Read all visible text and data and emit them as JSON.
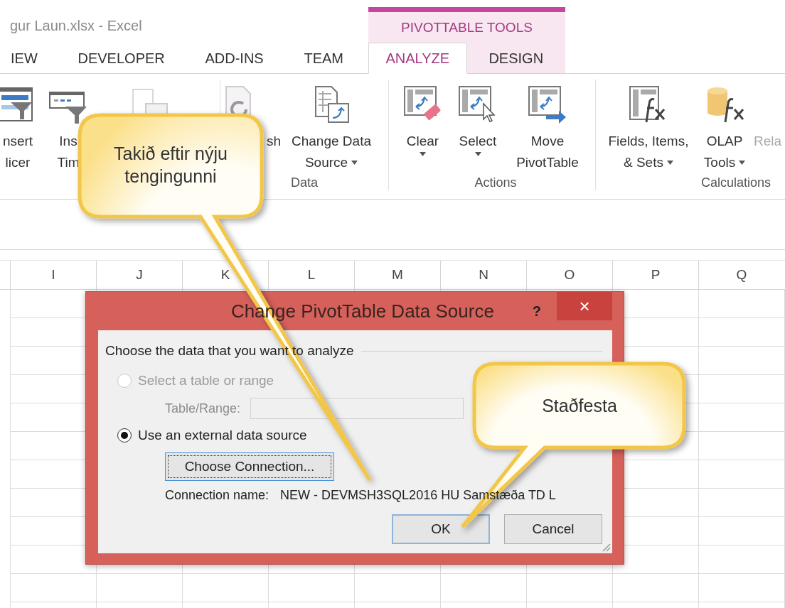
{
  "window": {
    "title": "gur Laun.xlsx - Excel"
  },
  "contextual_group": {
    "label": "PIVOTTABLE TOOLS"
  },
  "tabs": [
    {
      "label": "IEW",
      "selected": false,
      "contextual": false
    },
    {
      "label": "DEVELOPER",
      "selected": false,
      "contextual": false
    },
    {
      "label": "ADD-INS",
      "selected": false,
      "contextual": false
    },
    {
      "label": "TEAM",
      "selected": false,
      "contextual": false
    },
    {
      "label": "ANALYZE",
      "selected": true,
      "contextual": true
    },
    {
      "label": "DESIGN",
      "selected": false,
      "contextual": true
    }
  ],
  "ribbon": {
    "groups": [
      {
        "buttons": [
          {
            "lines": [
              "nsert",
              "licer"
            ],
            "dropdown": false,
            "disabled": false
          },
          {
            "lines": [
              "Ins",
              "Tim"
            ],
            "dropdown": false,
            "disabled": false
          },
          {
            "dropdown": false,
            "disabled": true
          }
        ]
      },
      {
        "label": "Data",
        "buttons": [
          {
            "lines": [
              "sh"
            ],
            "dropdown": false,
            "disabled": false
          },
          {
            "lines": [
              "Change Data",
              "Source"
            ],
            "dropdown": true,
            "disabled": false
          }
        ]
      },
      {
        "label": "Actions",
        "buttons": [
          {
            "lines": [
              "Clear"
            ],
            "dropdown": true,
            "disabled": false
          },
          {
            "lines": [
              "Select"
            ],
            "dropdown": true,
            "disabled": false
          },
          {
            "lines": [
              "Move",
              "PivotTable"
            ],
            "dropdown": false,
            "disabled": false
          }
        ]
      },
      {
        "label": "Calculations",
        "buttons": [
          {
            "lines": [
              "Fields, Items,",
              "& Sets"
            ],
            "dropdown": true,
            "disabled": false
          },
          {
            "lines": [
              "OLAP",
              "Tools"
            ],
            "dropdown": true,
            "disabled": false
          },
          {
            "lines": [
              "Rela"
            ],
            "dropdown": false,
            "disabled": true
          }
        ]
      }
    ]
  },
  "columns": [
    "I",
    "J",
    "K",
    "L",
    "M",
    "N",
    "O",
    "P",
    "Q"
  ],
  "dialog": {
    "title": "Change PivotTable Data Source",
    "help": "?",
    "close": "×",
    "section": "Choose the data that you want to analyze",
    "options": [
      {
        "label": "Select a table or range",
        "selected": false,
        "disabled": true
      },
      {
        "label": "Use an external data source",
        "selected": true,
        "disabled": false
      }
    ],
    "range_field": {
      "label": "Table/Range:",
      "disabled": true
    },
    "choose_button": {
      "label": "Choose Connection...",
      "focused": true
    },
    "connection": {
      "label": "Connection name:",
      "value": "NEW - DEVMSH3SQL2016 HU Samstæða TD L"
    },
    "buttons": [
      {
        "label": "OK",
        "default": true
      },
      {
        "label": "Cancel",
        "default": false
      }
    ]
  },
  "callouts": [
    {
      "text": "Takið eftir nýju tengingunni"
    },
    {
      "text": "Staðfesta"
    }
  ]
}
